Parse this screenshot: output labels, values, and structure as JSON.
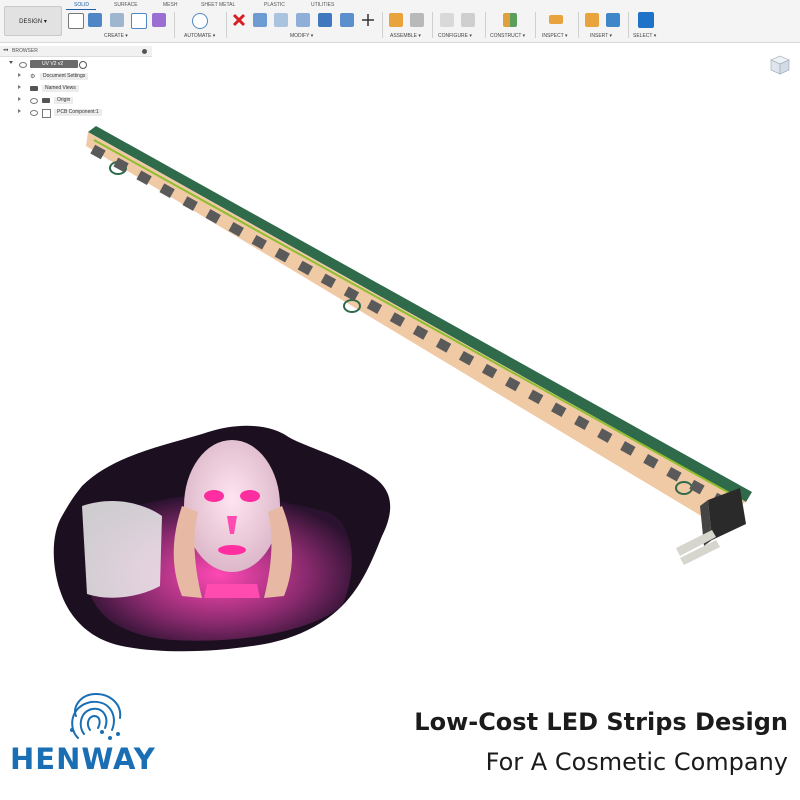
{
  "toolbar": {
    "design_label": "DESIGN ▾",
    "tabs": [
      "SOLID",
      "SURFACE",
      "MESH",
      "SHEET METAL",
      "PLASTIC",
      "UTILITIES"
    ],
    "groups": [
      "CREATE ▾",
      "AUTOMATE ▾",
      "MODIFY ▾",
      "ASSEMBLE ▾",
      "CONFIGURE ▾",
      "CONSTRUCT ▾",
      "INSPECT ▾",
      "INSERT ▾",
      "SELECT ▾"
    ]
  },
  "browser": {
    "title": "BROWSER",
    "items": [
      {
        "label": "UV V2 v2"
      },
      {
        "label": "Document Settings"
      },
      {
        "label": "Named Views"
      },
      {
        "label": "Origin"
      },
      {
        "label": "PCB Component:1"
      }
    ]
  },
  "brand": {
    "name": "HENWAY"
  },
  "headline": {
    "line1": "Low-Cost LED Strips Design",
    "line2": "For A Cosmetic Company"
  },
  "colors": {
    "pcb_green": "#2f6a4a",
    "pcb_face": "#f0c9a5",
    "trace": "#8fbf2f",
    "led": "#5a5a5a",
    "accent": "#1e5fa8",
    "brand_blue": "#1a6fb4",
    "mask_glow": "#e0369a"
  }
}
